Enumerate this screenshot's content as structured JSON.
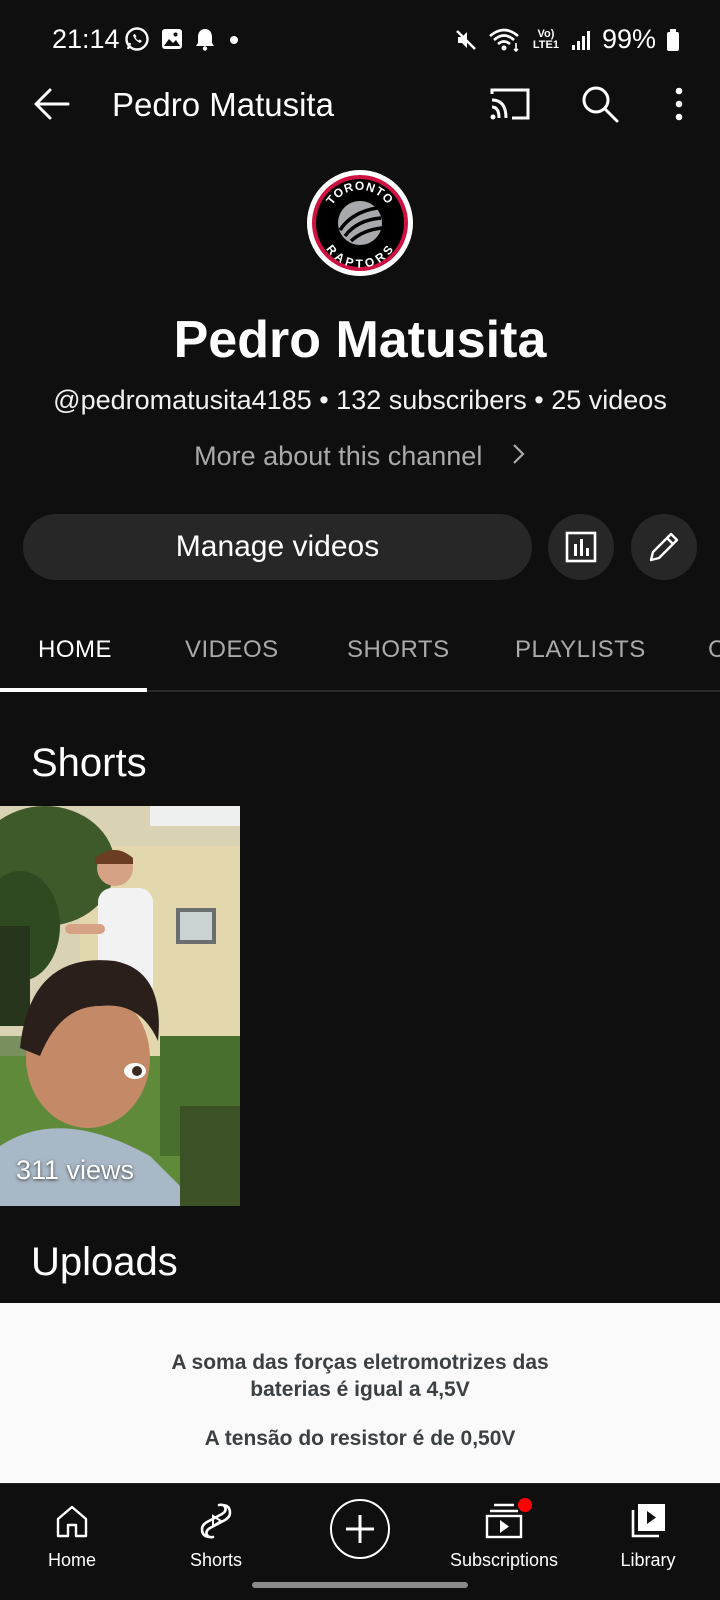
{
  "status_bar": {
    "time": "21:14",
    "battery": "99%",
    "network": "Vo) LTE1",
    "left_icons": [
      "whatsapp-icon",
      "gallery-icon",
      "bell-icon",
      "dot-icon"
    ],
    "right_icons": [
      "mute-icon",
      "wifi-icon",
      "signal-icon",
      "battery-icon"
    ]
  },
  "app_bar": {
    "title": "Pedro Matusita",
    "icons": [
      "back-arrow-icon",
      "cast-icon",
      "search-icon",
      "more-vert-icon"
    ]
  },
  "channel": {
    "avatar_text_top": "TORONTO",
    "avatar_text_bottom": "RAPTORS",
    "name": "Pedro Matusita",
    "meta": "@pedromatusita4185 • 132 subscribers • 25 videos",
    "more_about": "More about this channel",
    "manage_videos": "Manage videos"
  },
  "tabs": [
    {
      "label": "HOME",
      "active": true
    },
    {
      "label": "VIDEOS",
      "active": false
    },
    {
      "label": "SHORTS",
      "active": false
    },
    {
      "label": "PLAYLISTS",
      "active": false
    },
    {
      "label": "C",
      "active": false
    }
  ],
  "shorts": {
    "title": "Shorts",
    "items": [
      {
        "views": "311 views"
      }
    ]
  },
  "uploads": {
    "title": "Uploads",
    "thumb_line1": "A soma das forças eletromotrizes das",
    "thumb_line1b": "baterias é igual a 4,5V",
    "thumb_line2": "A tensão do resistor é de 0,50V"
  },
  "bottom_nav": {
    "home": "Home",
    "shorts": "Shorts",
    "subscriptions": "Subscriptions",
    "library": "Library"
  },
  "colors": {
    "background": "#0f0f0f",
    "button_bg": "#272727",
    "raptors_red": "#ce1141",
    "notification_dot": "#ff0000"
  }
}
